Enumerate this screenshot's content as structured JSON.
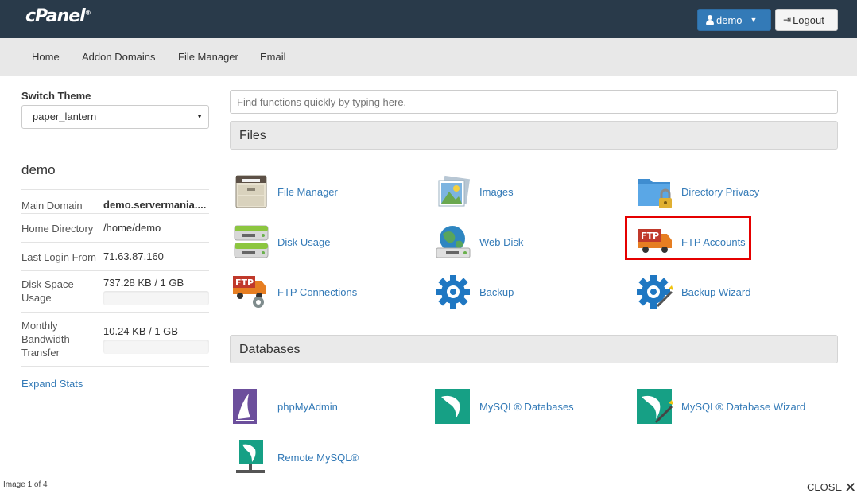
{
  "app": {
    "logo": "cPanel",
    "logo_mark": "®"
  },
  "topbar": {
    "user_label": "demo",
    "logout_label": "Logout"
  },
  "nav": [
    "Home",
    "Addon Domains",
    "File Manager",
    "Email"
  ],
  "sidebar": {
    "switch_theme_title": "Switch Theme",
    "theme_selected": "paper_lantern",
    "account_name": "demo",
    "stats": [
      {
        "label": "Main Domain",
        "value": "demo.servermania...."
      },
      {
        "label": "Home Directory",
        "value": "/home/demo"
      },
      {
        "label": "Last Login From",
        "value": "71.63.87.160"
      },
      {
        "label": "Disk Space Usage",
        "value": "737.28 KB / 1 GB",
        "usage_fraction": 0.0007
      },
      {
        "label": "Monthly Bandwidth Transfer",
        "value": "10.24 KB / 1 GB",
        "usage_fraction": 0.0
      }
    ],
    "expand_stats": "Expand Stats"
  },
  "search": {
    "placeholder": "Find functions quickly by typing here."
  },
  "sections": [
    {
      "title": "Files",
      "items": [
        {
          "label": "File Manager",
          "icon": "file-cabinet-icon"
        },
        {
          "label": "Images",
          "icon": "images-icon"
        },
        {
          "label": "Directory Privacy",
          "icon": "folder-lock-icon"
        },
        {
          "label": "Disk Usage",
          "icon": "disk-usage-icon"
        },
        {
          "label": "Web Disk",
          "icon": "web-disk-icon"
        },
        {
          "label": "FTP Accounts",
          "icon": "ftp-truck-icon",
          "highlighted": true
        },
        {
          "label": "FTP Connections",
          "icon": "ftp-connections-icon"
        },
        {
          "label": "Backup",
          "icon": "backup-gear-icon"
        },
        {
          "label": "Backup Wizard",
          "icon": "backup-wizard-icon"
        }
      ]
    },
    {
      "title": "Databases",
      "items": [
        {
          "label": "phpMyAdmin",
          "icon": "phpmyadmin-icon"
        },
        {
          "label": "MySQL® Databases",
          "icon": "mysql-dolphin-icon"
        },
        {
          "label": "MySQL® Database Wizard",
          "icon": "mysql-wizard-icon"
        },
        {
          "label": "Remote MySQL®",
          "icon": "remote-mysql-icon"
        }
      ]
    }
  ],
  "footer": {
    "image_counter": "Image 1 of 4",
    "close_label": "CLOSE"
  },
  "colors": {
    "topbar": "#293a4a",
    "link": "#337ab7",
    "accent_button": "#337ab7",
    "highlight": "#e50000"
  }
}
